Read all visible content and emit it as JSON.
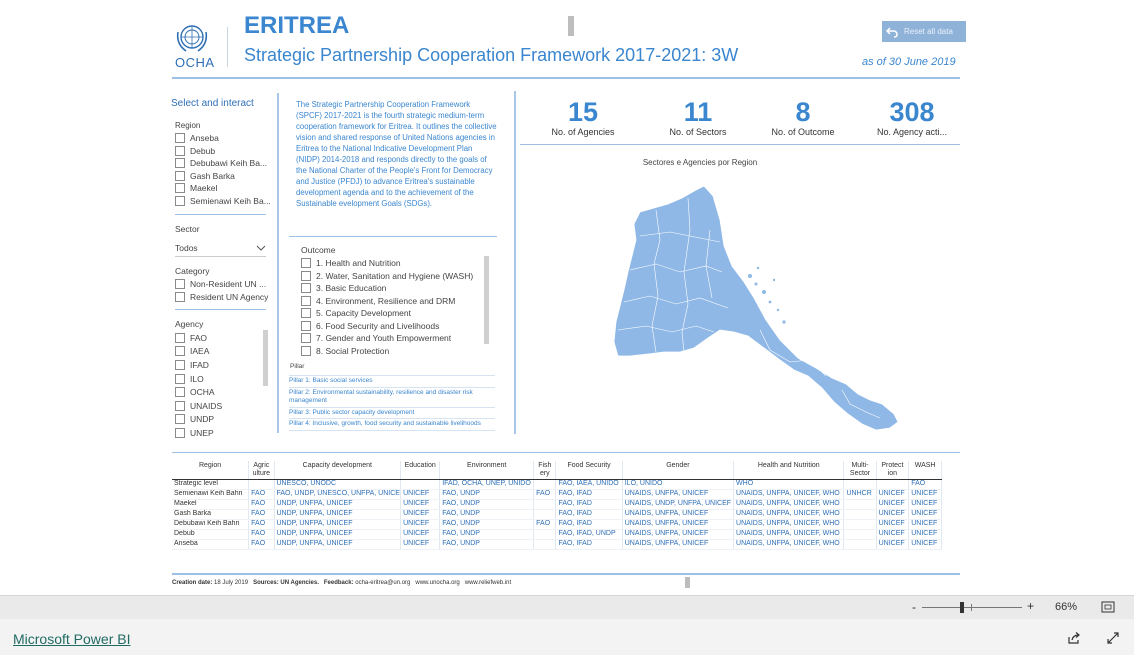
{
  "header": {
    "logo_text": "OCHA",
    "title": "ERITREA",
    "subtitle": "Strategic Partnership Cooperation Framework 2017-2021: 3W",
    "reset_label": "Reset all data",
    "as_of": "as of 30 June 2019"
  },
  "filters": {
    "title": "Select and interact",
    "region_label": "Region",
    "regions": [
      "Anseba",
      "Debub",
      "Debubawi Keih Ba...",
      "Gash Barka",
      "Maekel",
      "Semienawi Keih Ba..."
    ],
    "sector_label": "Sector",
    "sector_value": "Todos",
    "category_label": "Category",
    "categories": [
      "Non-Resident UN ...",
      "Resident UN Agency"
    ],
    "agency_label": "Agency",
    "agencies": [
      "FAO",
      "IAEA",
      "IFAD",
      "ILO",
      "OCHA",
      "UNAIDS",
      "UNDP",
      "UNEP"
    ]
  },
  "description": "The Strategic Partnership Cooperation Framework (SPCF) 2017-2021 is the fourth strategic medium-term cooperation framework for Eritrea. It outlines the collective vision and shared response of United Nations agencies in Eritrea to the National Indicative Development Plan (NIDP) 2014-2018 and responds directly to the goals of the National Charter of the People's Front for Democracy and Justice (PFDJ) to advance Eritrea's sustainable development agenda and to the achievement of the Sustainable evelopment Goals (SDGs).",
  "outcome": {
    "label": "Outcome",
    "items": [
      "1. Health and Nutrition",
      "2. Water, Sanitation and Hygiene (WASH)",
      "3. Basic Education",
      "4. Environment, Resilience and DRM",
      "5. Capacity Development",
      "6. Food Security and Livelihoods",
      "7. Gender and Youth Empowerment",
      "8. Social Protection"
    ]
  },
  "pillar": {
    "label": "Pillar",
    "items": [
      "Pillar 1: Basic social services",
      "Pillar 2: Environmental sustainability, resilience and disaster risk management",
      "Pillar 3: Public sector capacity development",
      "Pillar 4: Inclusive, growth, food security and sustainable livelihoods"
    ]
  },
  "kpis": [
    {
      "value": "15",
      "label": "No. of Agencies"
    },
    {
      "value": "11",
      "label": "No. of Sectors"
    },
    {
      "value": "8",
      "label": "No. of Outcome"
    },
    {
      "value": "308",
      "label": "No. Agency acti..."
    }
  ],
  "map": {
    "title": "Sectores e Agencies por Region",
    "fill_color": "#8fb8e6"
  },
  "table": {
    "headers": [
      "Region",
      "Agric ulture",
      "Capacity development",
      "Education",
      "Environment",
      "Fish ery",
      "Food Security",
      "Gender",
      "Health and Nutrition",
      "Multi-Sector",
      "Protect ion",
      "WASH"
    ],
    "rows": [
      [
        "Strategic level",
        "",
        "UNESCO, UNODC",
        "",
        "IFAD, OCHA, UNEP, UNIDO",
        "",
        "FAO, IAEA, UNIDO",
        "ILO, UNIDO",
        "WHO",
        "",
        "",
        "FAO"
      ],
      [
        "Semienawi Keih Bahri",
        "FAO",
        "FAO, UNDP, UNESCO, UNFPA, UNICEF",
        "UNICEF",
        "FAO, UNDP",
        "FAO",
        "FAO, IFAD",
        "UNAIDS, UNFPA, UNICEF",
        "UNAIDS, UNFPA, UNICEF, WHO",
        "UNHCR",
        "UNICEF",
        "UNICEF"
      ],
      [
        "Maekel",
        "FAO",
        "UNDP, UNFPA, UNICEF",
        "UNICEF",
        "FAO, UNDP",
        "",
        "FAO, IFAD",
        "UNAIDS, UNDP, UNFPA, UNICEF",
        "UNAIDS, UNFPA, UNICEF, WHO",
        "",
        "UNICEF",
        "UNICEF"
      ],
      [
        "Gash Barka",
        "FAO",
        "UNDP, UNFPA, UNICEF",
        "UNICEF",
        "FAO, UNDP",
        "",
        "FAO, IFAD",
        "UNAIDS, UNFPA, UNICEF",
        "UNAIDS, UNFPA, UNICEF, WHO",
        "",
        "UNICEF",
        "UNICEF"
      ],
      [
        "Debubawi Keih Bahri",
        "FAO",
        "UNDP, UNFPA, UNICEF",
        "UNICEF",
        "FAO, UNDP",
        "FAO",
        "FAO, IFAD",
        "UNAIDS, UNFPA, UNICEF",
        "UNAIDS, UNFPA, UNICEF, WHO",
        "",
        "UNICEF",
        "UNICEF"
      ],
      [
        "Debub",
        "FAO",
        "UNDP, UNFPA, UNICEF",
        "UNICEF",
        "FAO, UNDP",
        "",
        "FAO, IFAD, UNDP",
        "UNAIDS, UNFPA, UNICEF",
        "UNAIDS, UNFPA, UNICEF, WHO",
        "",
        "UNICEF",
        "UNICEF"
      ],
      [
        "Anseba",
        "FAO",
        "UNDP, UNFPA, UNICEF",
        "UNICEF",
        "FAO, UNDP",
        "",
        "FAO, IFAD",
        "UNAIDS, UNFPA, UNICEF",
        "UNAIDS, UNFPA, UNICEF, WHO",
        "",
        "UNICEF",
        "UNICEF"
      ]
    ]
  },
  "footer": {
    "creation_label": "Creation date:",
    "creation_value": "18 July 2019",
    "sources_label": "Sources: UN Agencies.",
    "feedback_label": "Feedback:",
    "feedback_value": "ocha-eritrea@un.org",
    "link1": "www.unocha.org",
    "link2": "www.reliefweb.int"
  },
  "zoom": {
    "minus": "-",
    "plus": "+",
    "value": "66%",
    "level": 0.4
  },
  "app": {
    "link_label": "Microsoft Power BI"
  },
  "icons": {
    "reset": "undo-arrow-icon",
    "fit": "fit-to-page-icon",
    "share": "share-icon",
    "fullscreen": "expand-icon"
  }
}
